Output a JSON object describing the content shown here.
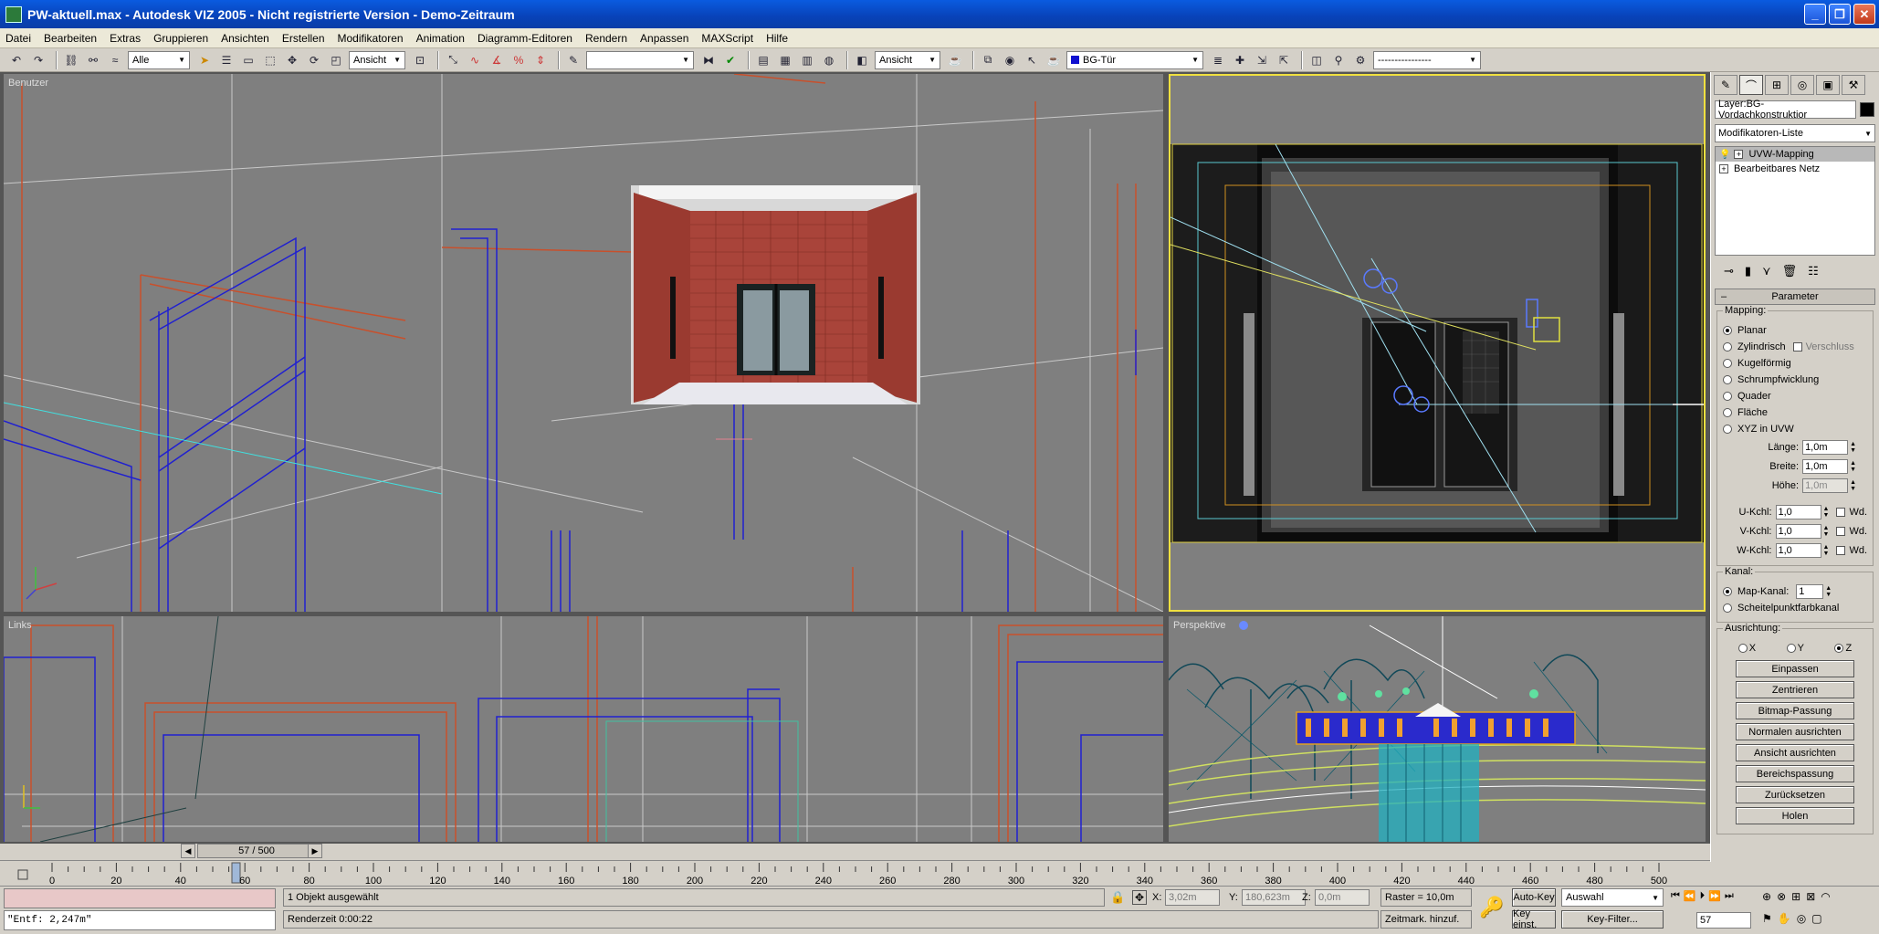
{
  "window": {
    "title": "PW-aktuell.max - Autodesk VIZ 2005 - Nicht registrierte Version - Demo-Zeitraum",
    "minimize": "_",
    "restore": "❐",
    "close": "✕"
  },
  "menu": [
    "Datei",
    "Bearbeiten",
    "Extras",
    "Gruppieren",
    "Ansichten",
    "Erstellen",
    "Modifikatoren",
    "Animation",
    "Diagramm-Editoren",
    "Rendern",
    "Anpassen",
    "MAXScript",
    "Hilfe"
  ],
  "toolbar": {
    "selection_filter": "Alle",
    "reference_coord": "Ansicht",
    "named_selection": "",
    "view_select": "Ansicht",
    "layer": "BG-Tür",
    "layer_color": "#1010d0",
    "right_dropdown": "----------------"
  },
  "viewports": {
    "top_left_label": "Benutzer",
    "bottom_left_label": "Links",
    "bottom_right_label": "Perspektive",
    "active_border": "#f0e040"
  },
  "command_panel": {
    "object_name": "Layer:BG-Vordachkonstruktior",
    "object_color": "#000000",
    "modifier_list": "Modifikatoren-Liste",
    "stack": [
      {
        "label": "UVW-Mapping",
        "selected": true
      },
      {
        "label": "Bearbeitbares Netz",
        "selected": false
      }
    ],
    "rollout_title": "Parameter",
    "mapping_group": "Mapping:",
    "mapping_options": [
      {
        "label": "Planar",
        "on": true
      },
      {
        "label": "Zylindrisch",
        "on": false
      },
      {
        "label": "Kugelförmig",
        "on": false
      },
      {
        "label": "Schrumpfwicklung",
        "on": false
      },
      {
        "label": "Quader",
        "on": false
      },
      {
        "label": "Fläche",
        "on": false
      },
      {
        "label": "XYZ in UVW",
        "on": false
      }
    ],
    "verschluss_label": "Verschluss",
    "laenge_label": "Länge:",
    "laenge_value": "1,0m",
    "breite_label": "Breite:",
    "breite_value": "1,0m",
    "hoehe_label": "Höhe:",
    "hoehe_value": "1,0m",
    "u_label": "U-Kchl:",
    "u_value": "1,0",
    "v_label": "V-Kchl:",
    "v_value": "1,0",
    "w_label": "W-Kchl:",
    "w_value": "1,0",
    "wd_label": "Wd.",
    "kanal_group": "Kanal:",
    "map_kanal_label": "Map-Kanal:",
    "map_kanal_value": "1",
    "scheitel_label": "Scheitelpunktfarbkanal",
    "ausrichtung_group": "Ausrichtung:",
    "axis_x": "X",
    "axis_y": "Y",
    "axis_z": "Z",
    "buttons": [
      "Einpassen",
      "Zentrieren",
      "Bitmap-Passung",
      "Normalen ausrichten",
      "Ansicht ausrichten",
      "Bereichspassung",
      "Zurücksetzen",
      "Holen"
    ]
  },
  "timeline": {
    "slider_label": "57 / 500",
    "ticks": [
      "0",
      "20",
      "40",
      "60",
      "80",
      "100",
      "120",
      "140",
      "160",
      "180",
      "200",
      "220",
      "240",
      "260",
      "280",
      "300",
      "320",
      "340",
      "360",
      "380",
      "400",
      "420",
      "440",
      "460",
      "480",
      "500"
    ]
  },
  "status": {
    "script_output": "\"Entf: 2,247m\"",
    "selection_info": "1 Objekt ausgewählt",
    "render_time": "Renderzeit  0:00:22",
    "x_label": "X:",
    "x_value": "3,02m",
    "y_label": "Y:",
    "y_value": "180,623m",
    "z_label": "Z:",
    "z_value": "0,0m",
    "grid": "Raster = 10,0m",
    "add_time_tag": "Zeitmark. hinzuf.",
    "auto_key": "Auto-Key",
    "set_key": "Key einst.",
    "key_mode": "Auswahl",
    "key_filter": "Key-Filter...",
    "current_frame": "57"
  }
}
